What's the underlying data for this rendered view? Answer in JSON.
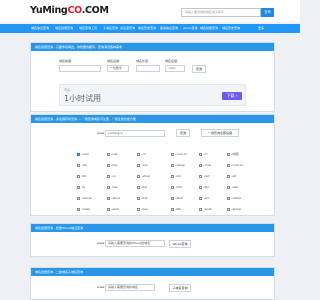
{
  "header": {
    "logo_main": "YuMing",
    "logo_red": "CO",
    "logo_tail": ".COM",
    "search_placeholder": "请输入要查询的域名或关键字",
    "search_button": "查询"
  },
  "nav": {
    "items": [
      "域名信息查询",
      "域名批量查询",
      "域名查询工具",
      "子域名查询",
      "关注度查询",
      "域名历史查询",
      "备案信息查询",
      "whois查询",
      "域名批量查询",
      "域名历史查询",
      "更多"
    ]
  },
  "panel1": {
    "title": "域名批量查询 - 只要你说得出，你想要的都有，查询满足各种需求",
    "label_word": "域名前缀:",
    "label_type": "域名后缀:",
    "label_len": "域名长度:",
    "label_ext": "域名后缀:",
    "select_type": "一位数字",
    "select_ext": ".com",
    "search_button": "查询"
  },
  "ad": {
    "small": "节点",
    "big": "1小时试用",
    "button": "下载 ›"
  },
  "panel2": {
    "title": "域名批量查询 - 多后缀同时查询 — 一键查询域名可注册，一键注册也很方便",
    "input_label": "www.",
    "input_value": "yumingco",
    "suffix_button": "查询",
    "all_button": "一键查询全部后缀",
    "suffixes": [
      [
        ".com",
        ".net",
        ".cn",
        ".com.cn",
        ".cc",
        ".中国"
      ],
      [
        ".vip",
        ".top",
        ".xyz",
        ".wang",
        ".club",
        ".com.cn"
      ],
      [
        ".ltd",
        ".co",
        ".shop",
        ".ink",
        ".red",
        ".art"
      ],
      [
        ".tv",
        ".me",
        ".fun",
        ".info",
        ".biz",
        ".site"
      ],
      [
        ".online",
        ".store",
        ".link",
        ".tech",
        ".pro",
        ".name"
      ],
      [
        ".mobi",
        ".asia",
        ".live",
        ".life",
        ".work",
        ".group"
      ]
    ],
    "checked": [
      ".com"
    ]
  },
  "panel3": {
    "title": "域名批量查询 - 批量Whois信息查询",
    "input_label": "www.",
    "input_placeholder": "请输入需要查询的Whois的域名",
    "button": "Whois查询"
  },
  "panel4": {
    "title": "域名批量查询 - 二级域名子域名查询",
    "input_label": "www.",
    "input_placeholder": "请输入需要查询的域名",
    "button": "子域名查询"
  }
}
